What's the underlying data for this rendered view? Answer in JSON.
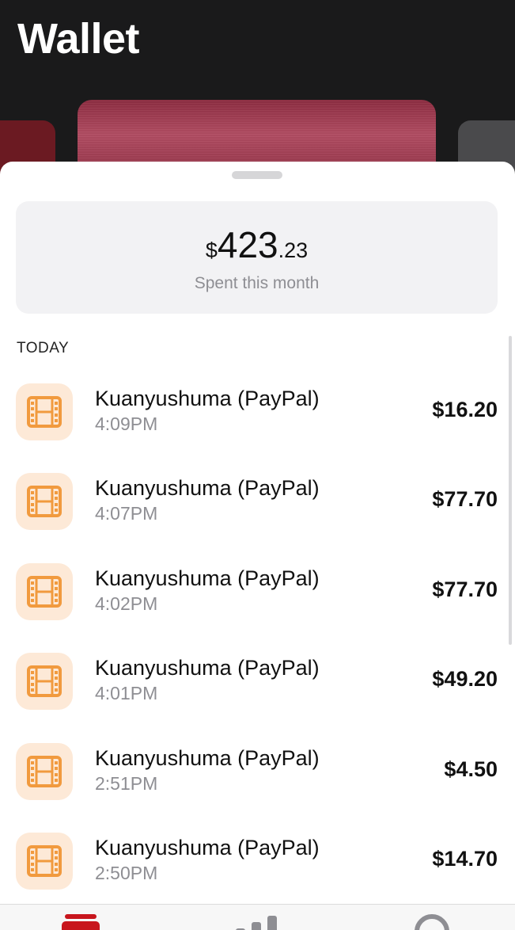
{
  "header": {
    "title": "Wallet"
  },
  "summary": {
    "currency": "$",
    "amount_main": "423",
    "amount_decimal": ".23",
    "label": "Spent this month"
  },
  "section": {
    "title": "TODAY"
  },
  "transactions": [
    {
      "merchant": "Kuanyushuma (PayPal)",
      "time": "4:09PM",
      "amount": "$16.20",
      "icon": "film-icon"
    },
    {
      "merchant": "Kuanyushuma (PayPal)",
      "time": "4:07PM",
      "amount": "$77.70",
      "icon": "film-icon"
    },
    {
      "merchant": "Kuanyushuma (PayPal)",
      "time": "4:02PM",
      "amount": "$77.70",
      "icon": "film-icon"
    },
    {
      "merchant": "Kuanyushuma (PayPal)",
      "time": "4:01PM",
      "amount": "$49.20",
      "icon": "film-icon"
    },
    {
      "merchant": "Kuanyushuma (PayPal)",
      "time": "2:51PM",
      "amount": "$4.50",
      "icon": "film-icon"
    },
    {
      "merchant": "Kuanyushuma (PayPal)",
      "time": "2:50PM",
      "amount": "$14.70",
      "icon": "film-icon"
    }
  ],
  "tabbar": {
    "tabs": [
      {
        "icon": "wallet-icon",
        "active": true
      },
      {
        "icon": "stats-icon",
        "active": false
      },
      {
        "icon": "profile-icon",
        "active": false
      }
    ]
  },
  "colors": {
    "accent": "#c8161d",
    "card": "#a03c52",
    "icon_bg": "#fde9d7",
    "icon_fg": "#f19a3e",
    "secondary_text": "#8e8e93"
  }
}
